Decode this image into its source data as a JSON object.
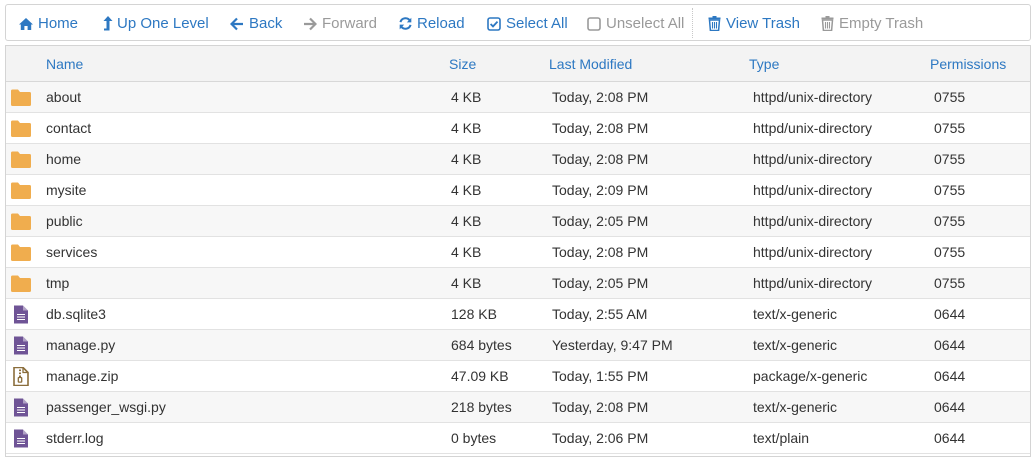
{
  "colors": {
    "accent": "#2d78c2",
    "disabled": "#9a9a9a",
    "folder": "#f0ad4e",
    "file": "#6f5496",
    "archive": "#8a6d3b"
  },
  "toolbar": {
    "buttons": [
      {
        "key": "home",
        "label": "Home",
        "icon": "home-icon",
        "enabled": true
      },
      {
        "key": "up",
        "label": "Up One Level",
        "icon": "level-up-icon",
        "enabled": true
      },
      {
        "key": "back",
        "label": "Back",
        "icon": "arrow-left-icon",
        "enabled": true
      },
      {
        "key": "forward",
        "label": "Forward",
        "icon": "arrow-right-icon",
        "enabled": false
      },
      {
        "key": "reload",
        "label": "Reload",
        "icon": "refresh-icon",
        "enabled": true
      },
      {
        "key": "select_all",
        "label": "Select All",
        "icon": "checked-box-icon",
        "enabled": true
      },
      {
        "key": "unselect_all",
        "label": "Unselect All",
        "icon": "empty-box-icon",
        "enabled": false
      },
      {
        "key": "view_trash",
        "label": "View Trash",
        "icon": "trash-icon",
        "enabled": true
      },
      {
        "key": "empty_trash",
        "label": "Empty Trash",
        "icon": "trash-icon",
        "enabled": false
      }
    ]
  },
  "table": {
    "columns": [
      "Name",
      "Size",
      "Last Modified",
      "Type",
      "Permissions"
    ],
    "rows": [
      {
        "name": "about",
        "size": "4 KB",
        "modified": "Today, 2:08 PM",
        "type": "httpd/unix-directory",
        "perms": "0755",
        "icon": "folder-icon"
      },
      {
        "name": "contact",
        "size": "4 KB",
        "modified": "Today, 2:08 PM",
        "type": "httpd/unix-directory",
        "perms": "0755",
        "icon": "folder-icon"
      },
      {
        "name": "home",
        "size": "4 KB",
        "modified": "Today, 2:08 PM",
        "type": "httpd/unix-directory",
        "perms": "0755",
        "icon": "folder-icon"
      },
      {
        "name": "mysite",
        "size": "4 KB",
        "modified": "Today, 2:09 PM",
        "type": "httpd/unix-directory",
        "perms": "0755",
        "icon": "folder-icon"
      },
      {
        "name": "public",
        "size": "4 KB",
        "modified": "Today, 2:05 PM",
        "type": "httpd/unix-directory",
        "perms": "0755",
        "icon": "folder-icon"
      },
      {
        "name": "services",
        "size": "4 KB",
        "modified": "Today, 2:08 PM",
        "type": "httpd/unix-directory",
        "perms": "0755",
        "icon": "folder-icon"
      },
      {
        "name": "tmp",
        "size": "4 KB",
        "modified": "Today, 2:05 PM",
        "type": "httpd/unix-directory",
        "perms": "0755",
        "icon": "folder-icon"
      },
      {
        "name": "db.sqlite3",
        "size": "128 KB",
        "modified": "Today, 2:55 AM",
        "type": "text/x-generic",
        "perms": "0644",
        "icon": "text-file-icon"
      },
      {
        "name": "manage.py",
        "size": "684 bytes",
        "modified": "Yesterday, 9:47 PM",
        "type": "text/x-generic",
        "perms": "0644",
        "icon": "text-file-icon"
      },
      {
        "name": "manage.zip",
        "size": "47.09 KB",
        "modified": "Today, 1:55 PM",
        "type": "package/x-generic",
        "perms": "0644",
        "icon": "archive-file-icon"
      },
      {
        "name": "passenger_wsgi.py",
        "size": "218 bytes",
        "modified": "Today, 2:08 PM",
        "type": "text/x-generic",
        "perms": "0644",
        "icon": "text-file-icon"
      },
      {
        "name": "stderr.log",
        "size": "0 bytes",
        "modified": "Today, 2:06 PM",
        "type": "text/plain",
        "perms": "0644",
        "icon": "text-file-icon"
      }
    ]
  }
}
